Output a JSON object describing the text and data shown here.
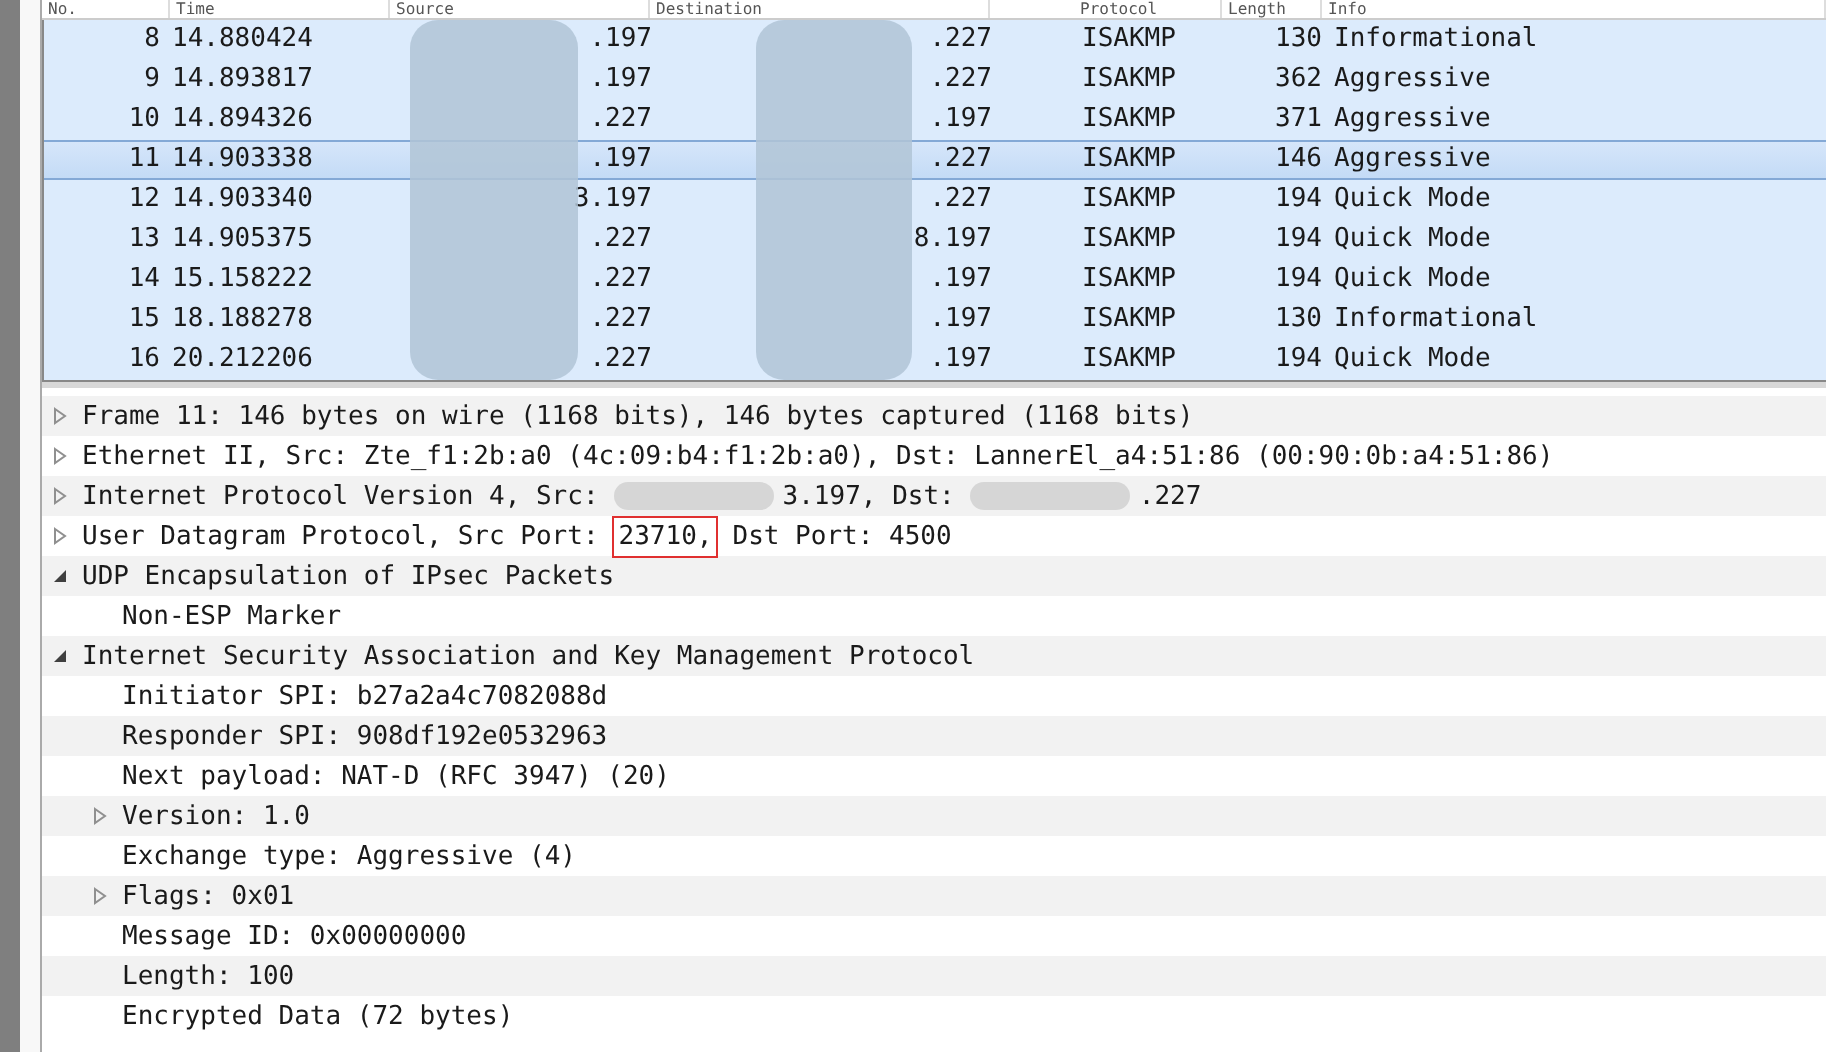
{
  "packet_list": {
    "columns": [
      {
        "label": "No."
      },
      {
        "label": "Time"
      },
      {
        "label": "Source"
      },
      {
        "label": "Destination"
      },
      {
        "label": "Protocol"
      },
      {
        "label": "Length"
      },
      {
        "label": "Info"
      }
    ],
    "rows": [
      {
        "no": "8",
        "time": "14.880424",
        "source": ".197",
        "destination": ".227",
        "protocol": "ISAKMP",
        "length": "130",
        "info": "Informational",
        "selected": false
      },
      {
        "no": "9",
        "time": "14.893817",
        "source": ".197",
        "destination": ".227",
        "protocol": "ISAKMP",
        "length": "362",
        "info": "Aggressive",
        "selected": false
      },
      {
        "no": "10",
        "time": "14.894326",
        "source": ".227",
        "destination": ".197",
        "protocol": "ISAKMP",
        "length": "371",
        "info": "Aggressive",
        "selected": false
      },
      {
        "no": "11",
        "time": "14.903338",
        "source": ".197",
        "destination": ".227",
        "protocol": "ISAKMP",
        "length": "146",
        "info": "Aggressive",
        "selected": true
      },
      {
        "no": "12",
        "time": "14.903340",
        "source": "3.197",
        "destination": ".227",
        "protocol": "ISAKMP",
        "length": "194",
        "info": "Quick Mode",
        "selected": false
      },
      {
        "no": "13",
        "time": "14.905375",
        "source": ".227",
        "destination": "8.197",
        "protocol": "ISAKMP",
        "length": "194",
        "info": "Quick Mode",
        "selected": false
      },
      {
        "no": "14",
        "time": "15.158222",
        "source": ".227",
        "destination": ".197",
        "protocol": "ISAKMP",
        "length": "194",
        "info": "Quick Mode",
        "selected": false
      },
      {
        "no": "15",
        "time": "18.188278",
        "source": ".227",
        "destination": ".197",
        "protocol": "ISAKMP",
        "length": "130",
        "info": "Informational",
        "selected": false
      },
      {
        "no": "16",
        "time": "20.212206",
        "source": ".227",
        "destination": ".197",
        "protocol": "ISAKMP",
        "length": "194",
        "info": "Quick Mode",
        "selected": false
      }
    ]
  },
  "packet_details": [
    {
      "expanded": false,
      "parts": [
        {
          "kind": "text",
          "text": "Frame 11: 146 bytes on wire (1168 bits), 146 bytes captured (1168 bits)"
        }
      ]
    },
    {
      "expanded": false,
      "parts": [
        {
          "kind": "text",
          "text": "Ethernet II, Src: Zte_f1:2b:a0 (4c:09:b4:f1:2b:a0), Dst: LannerEl_a4:51:86 (00:90:0b:a4:51:86)"
        }
      ]
    },
    {
      "expanded": false,
      "parts": [
        {
          "kind": "text",
          "text": "Internet Protocol Version 4, Src:"
        },
        {
          "kind": "blur"
        },
        {
          "kind": "text",
          "text": "3.197, Dst:"
        },
        {
          "kind": "blur"
        },
        {
          "kind": "text",
          "text": ".227"
        }
      ]
    },
    {
      "expanded": false,
      "parts": [
        {
          "kind": "text",
          "text": "User Datagram Protocol, Src Port:"
        },
        {
          "kind": "highlight",
          "text": "23710,"
        },
        {
          "kind": "text",
          "text": "Dst Port: 4500"
        }
      ]
    },
    {
      "expanded": true,
      "parts": [
        {
          "kind": "text",
          "text": "UDP Encapsulation of IPsec Packets"
        }
      ],
      "children": [
        {
          "parts": [
            {
              "kind": "text",
              "text": "Non-ESP Marker"
            }
          ]
        }
      ]
    },
    {
      "expanded": true,
      "parts": [
        {
          "kind": "text",
          "text": "Internet Security Association and Key Management Protocol"
        }
      ],
      "children": [
        {
          "parts": [
            {
              "kind": "text",
              "text": "Initiator SPI: b27a2a4c7082088d"
            }
          ]
        },
        {
          "parts": [
            {
              "kind": "text",
              "text": "Responder SPI: 908df192e0532963"
            }
          ]
        },
        {
          "parts": [
            {
              "kind": "text",
              "text": "Next payload: NAT-D (RFC 3947) (20)"
            }
          ]
        },
        {
          "expanded": false,
          "parts": [
            {
              "kind": "text",
              "text": "Version: 1.0"
            }
          ]
        },
        {
          "parts": [
            {
              "kind": "text",
              "text": "Exchange type: Aggressive (4)"
            }
          ]
        },
        {
          "expanded": false,
          "parts": [
            {
              "kind": "text",
              "text": "Flags: 0x01"
            }
          ]
        },
        {
          "parts": [
            {
              "kind": "text",
              "text": "Message ID: 0x00000000"
            }
          ]
        },
        {
          "parts": [
            {
              "kind": "text",
              "text": "Length: 100"
            }
          ]
        },
        {
          "parts": [
            {
              "kind": "text",
              "text": "Encrypted Data (72 bytes)"
            }
          ]
        }
      ]
    }
  ]
}
